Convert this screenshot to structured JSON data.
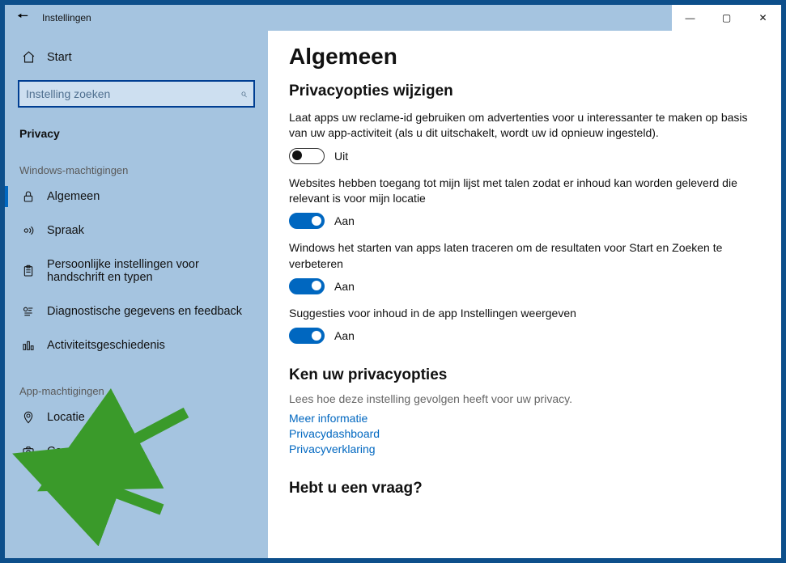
{
  "titlebar": {
    "app_title": "Instellingen"
  },
  "sidebar": {
    "start_label": "Start",
    "search_placeholder": "Instelling zoeken",
    "section_label": "Privacy",
    "group1_label": "Windows-machtigingen",
    "group2_label": "App-machtigingen",
    "items_win": [
      {
        "icon": "padlock",
        "label": "Algemeen",
        "selected": true
      },
      {
        "icon": "voice",
        "label": "Spraak"
      },
      {
        "icon": "clipboard",
        "label": "Persoonlijke instellingen voor handschrift en typen"
      },
      {
        "icon": "diag",
        "label": "Diagnostische gegevens en feedback"
      },
      {
        "icon": "activity",
        "label": "Activiteitsgeschiedenis"
      }
    ],
    "items_app": [
      {
        "icon": "location",
        "label": "Locatie"
      },
      {
        "icon": "camera",
        "label": "Camera"
      }
    ]
  },
  "main": {
    "heading": "Algemeen",
    "subheading": "Privacyopties wijzigen",
    "settings": [
      {
        "desc": "Laat apps uw reclame-id gebruiken om advertenties voor u interessanter te maken op basis van uw app-activiteit (als u dit uitschakelt, wordt uw id opnieuw ingesteld).",
        "state": "off",
        "state_label": "Uit"
      },
      {
        "desc": "Websites hebben toegang tot mijn lijst met talen zodat er inhoud kan worden geleverd die relevant is voor mijn locatie",
        "state": "on",
        "state_label": "Aan"
      },
      {
        "desc": "Windows het starten van apps laten traceren om de resultaten voor Start en Zoeken te verbeteren",
        "state": "on",
        "state_label": "Aan"
      },
      {
        "desc": "Suggesties voor inhoud in de app Instellingen weergeven",
        "state": "on",
        "state_label": "Aan"
      }
    ],
    "priv_heading": "Ken uw privacyopties",
    "priv_desc": "Lees hoe deze instelling gevolgen heeft voor uw privacy.",
    "links": [
      "Meer informatie",
      "Privacydashboard",
      "Privacyverklaring"
    ],
    "question": "Hebt u een vraag?"
  }
}
